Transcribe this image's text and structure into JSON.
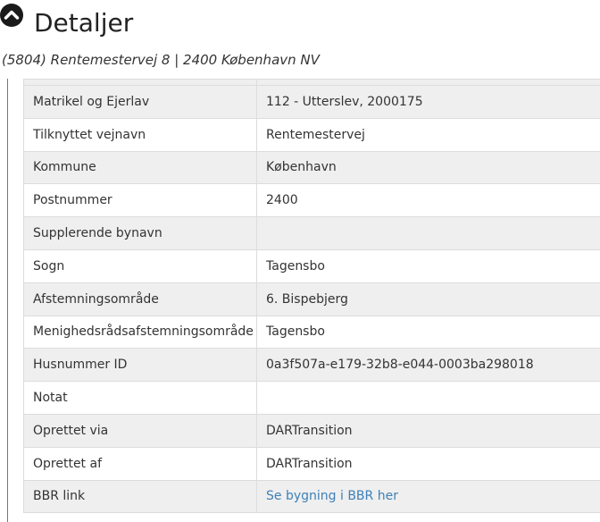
{
  "header": {
    "title": "Detaljer",
    "address": "(5804) Rentemestervej 8 | 2400 København NV"
  },
  "rows": [
    {
      "label": "Matrikel og Ejerlav",
      "value": "112 - Utterslev, 2000175"
    },
    {
      "label": "Tilknyttet vejnavn",
      "value": "Rentemestervej"
    },
    {
      "label": "Kommune",
      "value": "København"
    },
    {
      "label": "Postnummer",
      "value": "2400"
    },
    {
      "label": "Supplerende bynavn",
      "value": ""
    },
    {
      "label": "Sogn",
      "value": "Tagensbo"
    },
    {
      "label": "Afstemningsområde",
      "value": "6. Bispebjerg"
    },
    {
      "label": "Menighedsrådsafstemningsområde",
      "value": "Tagensbo"
    },
    {
      "label": "Husnummer ID",
      "value": "0a3f507a-e179-32b8-e044-0003ba298018"
    },
    {
      "label": "Notat",
      "value": ""
    },
    {
      "label": "Oprettet via",
      "value": "DARTransition"
    },
    {
      "label": "Oprettet af",
      "value": "DARTransition"
    },
    {
      "label": "BBR link",
      "value": "Se bygning i BBR her"
    }
  ],
  "colors": {
    "link": "#3d80b8",
    "stripe": "#efefef"
  }
}
